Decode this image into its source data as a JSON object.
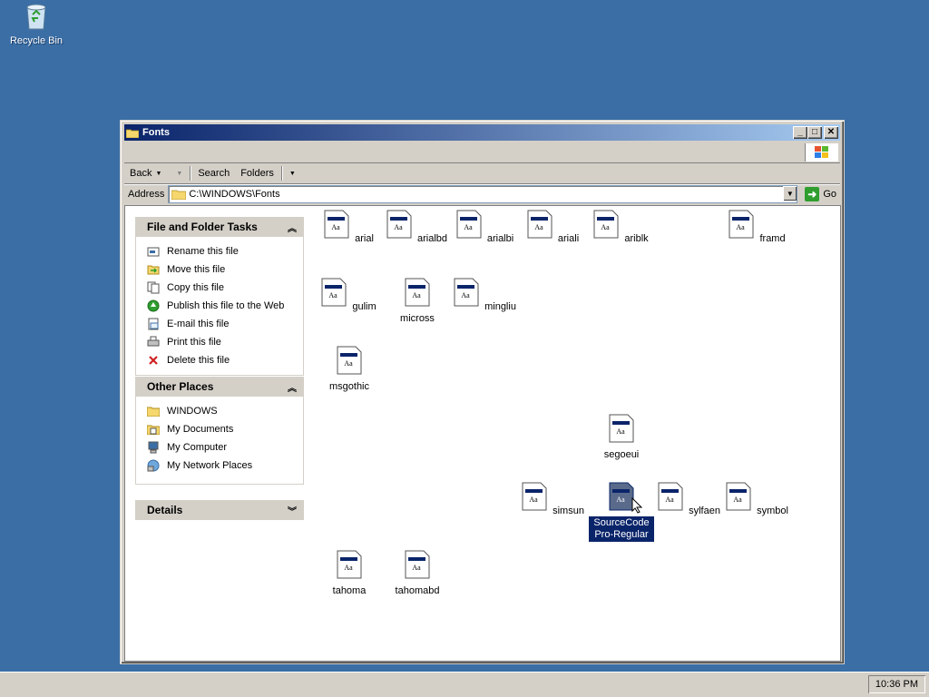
{
  "desktop": {
    "recycle_bin_label": "Recycle Bin"
  },
  "window": {
    "title": "Fonts",
    "toolbar": {
      "back": "Back",
      "search": "Search",
      "folders": "Folders"
    },
    "address": {
      "label": "Address",
      "value": "C:\\WINDOWS\\Fonts",
      "go": "Go"
    }
  },
  "tasks_panel": {
    "title": "File and Folder Tasks",
    "items": [
      {
        "label": "Rename this file",
        "icon": "rename-icon"
      },
      {
        "label": "Move this file",
        "icon": "move-icon"
      },
      {
        "label": "Copy this file",
        "icon": "copy-icon"
      },
      {
        "label": "Publish this file to the Web",
        "icon": "globe-icon"
      },
      {
        "label": "E-mail this file",
        "icon": "email-icon"
      },
      {
        "label": "Print this file",
        "icon": "printer-icon"
      },
      {
        "label": "Delete this file",
        "icon": "delete-icon"
      }
    ]
  },
  "places_panel": {
    "title": "Other Places",
    "items": [
      {
        "label": "WINDOWS",
        "icon": "folder-icon"
      },
      {
        "label": "My Documents",
        "icon": "documents-icon"
      },
      {
        "label": "My Computer",
        "icon": "computer-icon"
      },
      {
        "label": "My Network Places",
        "icon": "network-icon"
      }
    ]
  },
  "details_panel": {
    "title": "Details"
  },
  "files": [
    {
      "name": "arial"
    },
    {
      "name": "arialbd"
    },
    {
      "name": "arialbi"
    },
    {
      "name": "ariali"
    },
    {
      "name": "ariblk"
    },
    {
      "name": "framd"
    },
    {
      "name": "gulim"
    },
    {
      "name": "micross"
    },
    {
      "name": "mingliu"
    },
    {
      "name": "msgothic"
    },
    {
      "name": "segoeui"
    },
    {
      "name": "simsun"
    },
    {
      "name": "SourceCodePro-Regular",
      "selected": true
    },
    {
      "name": "sylfaen"
    },
    {
      "name": "symbol"
    },
    {
      "name": "tahoma"
    },
    {
      "name": "tahomabd"
    }
  ],
  "taskbar": {
    "clock": "10:36 PM"
  },
  "colors": {
    "desktop": "#3a6ea5",
    "titlebar_start": "#0a246a",
    "selection": "#0a246a"
  }
}
